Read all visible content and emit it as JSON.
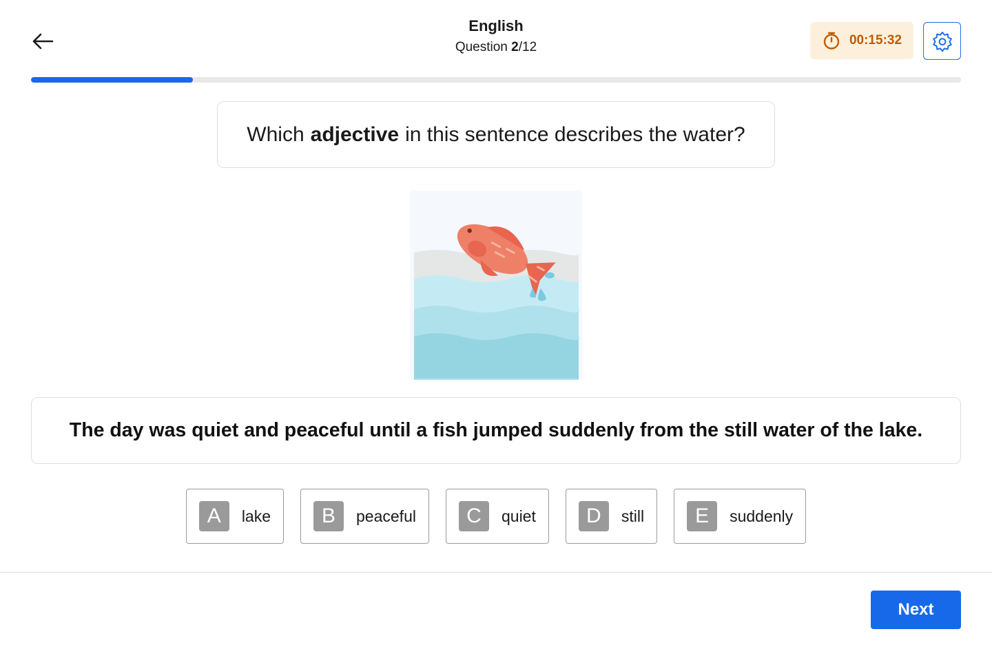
{
  "header": {
    "subject": "English",
    "question_label": "Question",
    "question_current": "2",
    "question_total": "/12"
  },
  "timer": {
    "value": "00:15:32",
    "icon": "stopwatch-icon"
  },
  "settings": {
    "icon": "gear-icon"
  },
  "progress": {
    "fraction": 0.174
  },
  "prompt": {
    "before": "Which",
    "emphasis": "adjective",
    "after": "in this sentence describes the water?"
  },
  "illustration": {
    "subject": "fish-jumping-from-water"
  },
  "sentence": "The day was quiet and peaceful until a fish jumped suddenly from the still water of the lake.",
  "options": [
    {
      "letter": "A",
      "text": "lake"
    },
    {
      "letter": "B",
      "text": "peaceful"
    },
    {
      "letter": "C",
      "text": "quiet"
    },
    {
      "letter": "D",
      "text": "still"
    },
    {
      "letter": "E",
      "text": "suddenly"
    }
  ],
  "footer": {
    "next_label": "Next"
  },
  "colors": {
    "accent": "#1769ea",
    "timer_bg": "#fcf0dd",
    "timer_text": "#c25a00",
    "option_letter_bg": "#9a9a9a"
  }
}
